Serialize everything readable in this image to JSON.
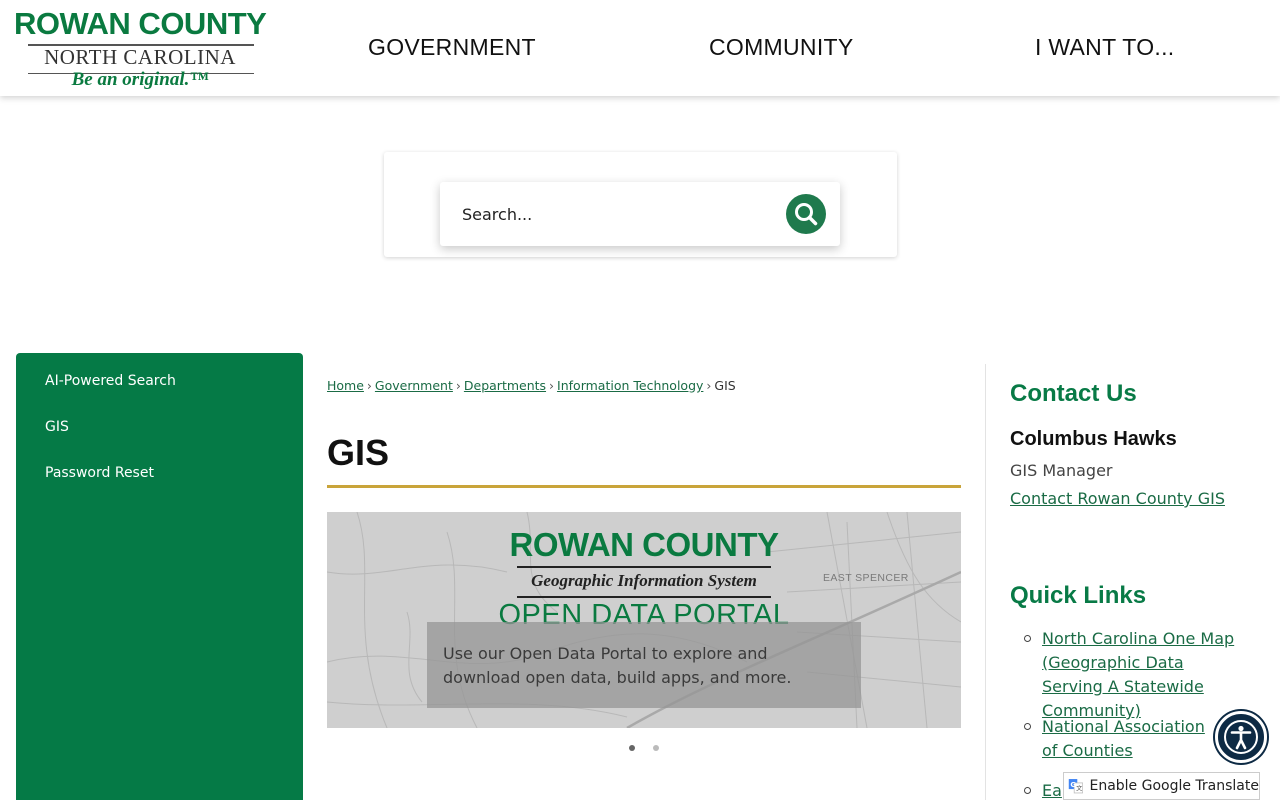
{
  "logo": {
    "line1": "ROWAN COUNTY",
    "line2": "NORTH CAROLINA",
    "line3": "Be an original.™"
  },
  "nav": {
    "government": "GOVERNMENT",
    "community": "COMMUNITY",
    "i_want_to": "I WANT TO..."
  },
  "search": {
    "placeholder": "Search..."
  },
  "sidebar": {
    "items": [
      {
        "label": "AI-Powered Search"
      },
      {
        "label": "GIS"
      },
      {
        "label": "Password Reset"
      }
    ]
  },
  "breadcrumb": {
    "items": [
      "Home",
      "Government",
      "Departments",
      "Information Technology"
    ],
    "current": "GIS",
    "separator": "›"
  },
  "page": {
    "title": "GIS"
  },
  "banner": {
    "title1": "ROWAN COUNTY",
    "title2": "Geographic Information System",
    "title3": "OPEN DATA PORTAL",
    "map_label": "EAST SPENCER",
    "caption": "Use our Open Data Portal to explore and download open data, build apps, and more."
  },
  "contact": {
    "heading": "Contact Us",
    "name": "Columbus Hawks",
    "title": "GIS Manager",
    "link": "Contact Rowan County GIS"
  },
  "quick_links": {
    "heading": "Quick Links",
    "items": [
      {
        "label": "North Carolina One Map (Geographic Data Serving A Statewide Community)"
      },
      {
        "label": "National Association of Counties"
      },
      {
        "label": "Ea"
      }
    ]
  },
  "translate": {
    "label": "Enable Google Translate"
  },
  "colors": {
    "brand_green": "#057a46",
    "accent_gold": "#c9a43a",
    "link_green": "#1a6b45"
  }
}
